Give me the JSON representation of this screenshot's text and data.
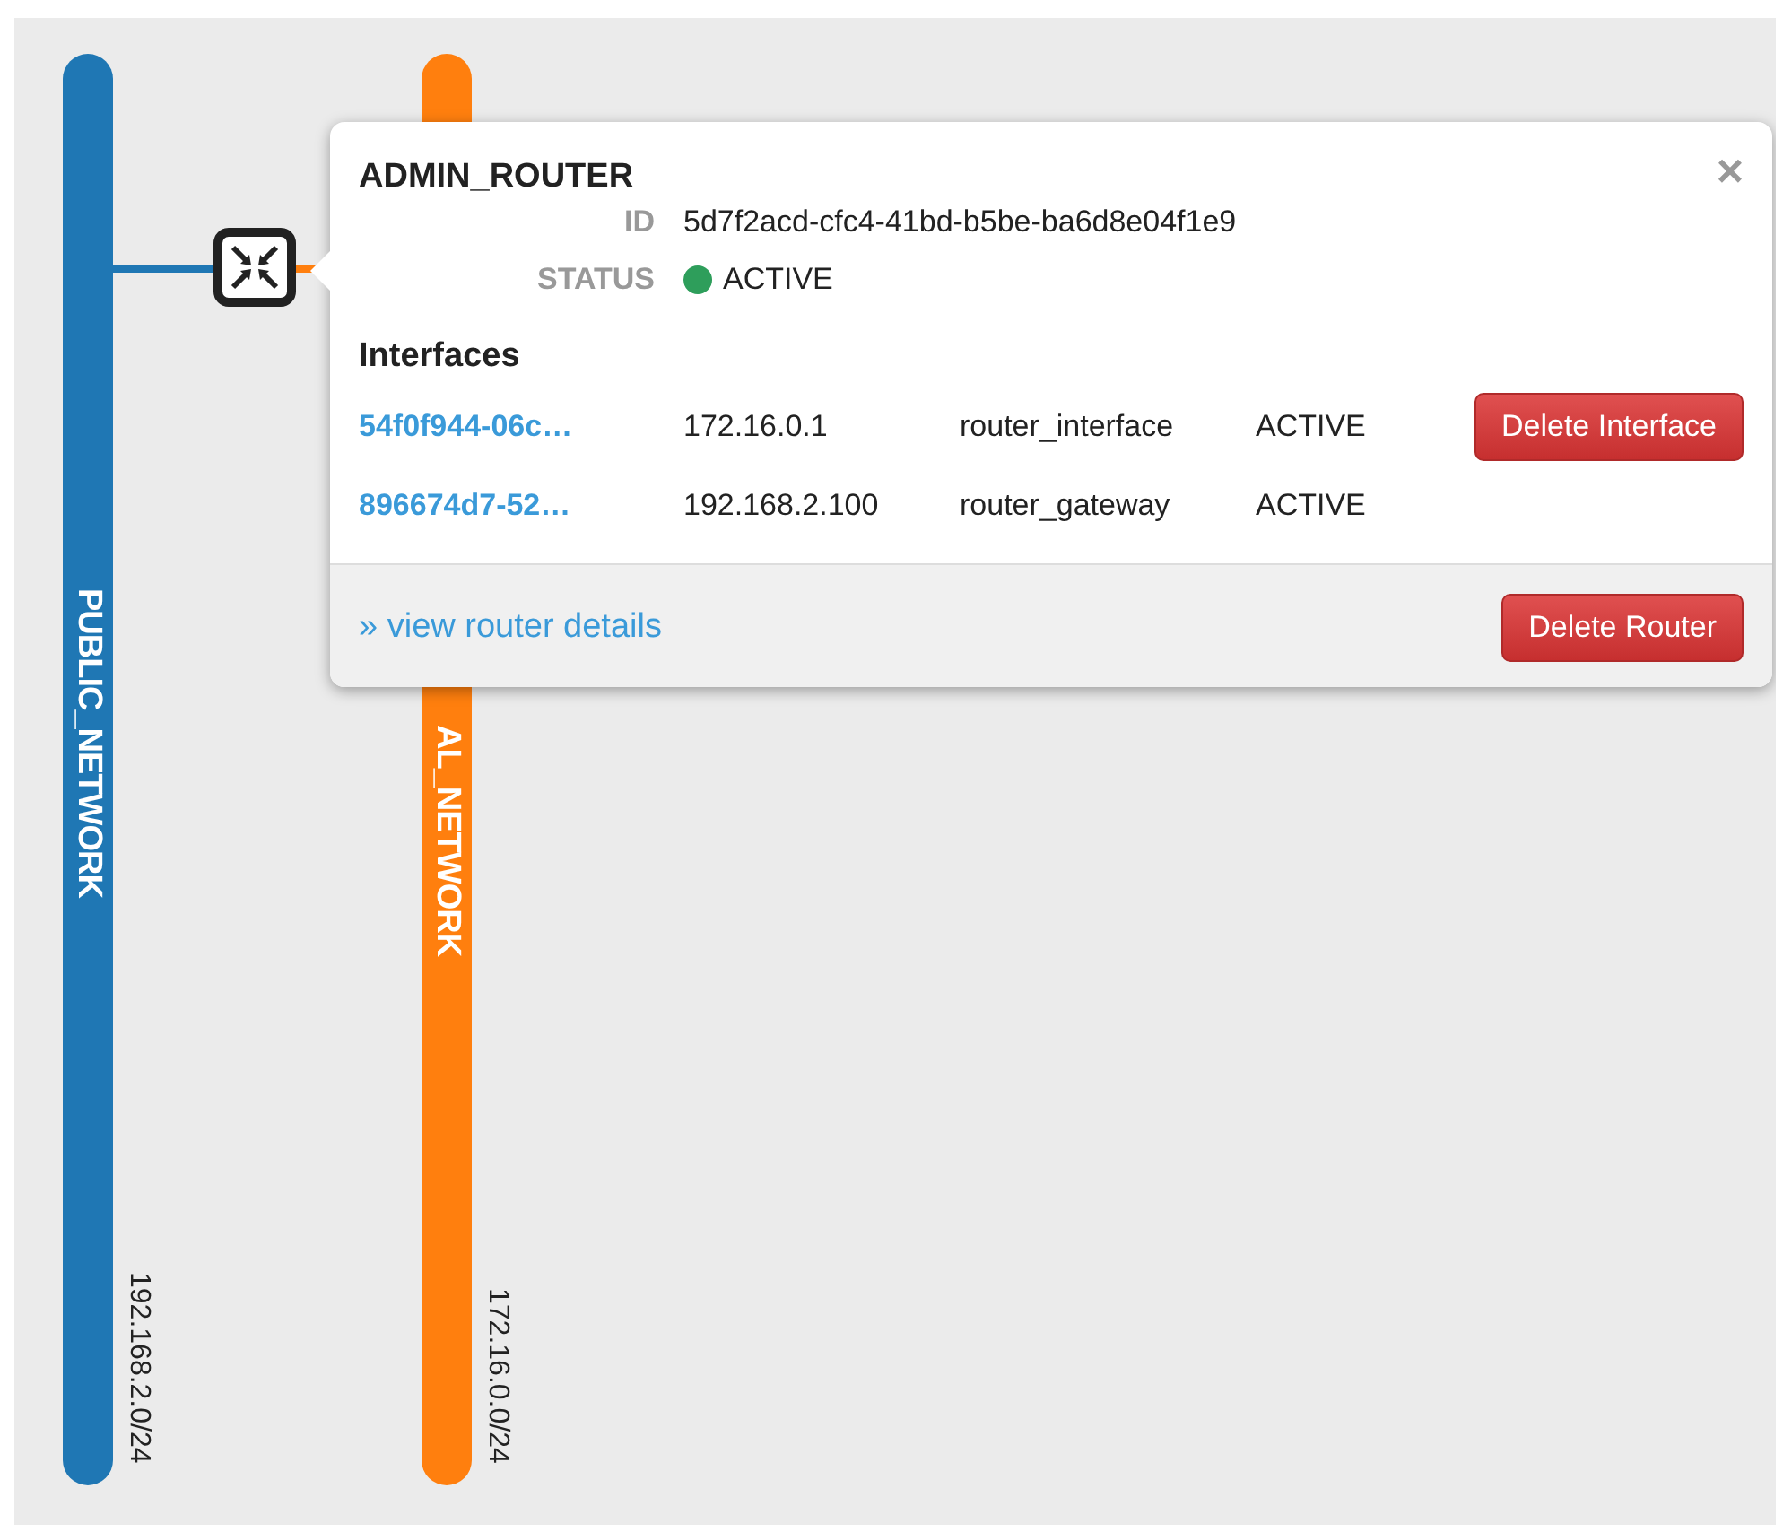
{
  "networks": [
    {
      "name": "PUBLIC_NETWORK",
      "subnet": "192.168.2.0/24",
      "color": "#1f77b4"
    },
    {
      "name": "AL_NETWORK",
      "subnet": "172.16.0.0/24",
      "color": "#ff7f0e"
    }
  ],
  "router_popover": {
    "title": "ADMIN_ROUTER",
    "close": "×",
    "fields": [
      {
        "kind": "text",
        "label": "ID",
        "value": "5d7f2acd-cfc4-41bd-b5be-ba6d8e04f1e9"
      },
      {
        "kind": "status",
        "label": "STATUS",
        "value": "ACTIVE"
      }
    ],
    "interfaces_heading": "Interfaces",
    "interfaces": [
      {
        "id": "54f0f944-06c…",
        "ip": "172.16.0.1",
        "type": "router_interface",
        "status": "ACTIVE",
        "action": "Delete Interface"
      },
      {
        "id": "896674d7-52…",
        "ip": "192.168.2.100",
        "type": "router_gateway",
        "status": "ACTIVE"
      }
    ],
    "details_link": "» view router details",
    "delete_button": "Delete Router"
  }
}
